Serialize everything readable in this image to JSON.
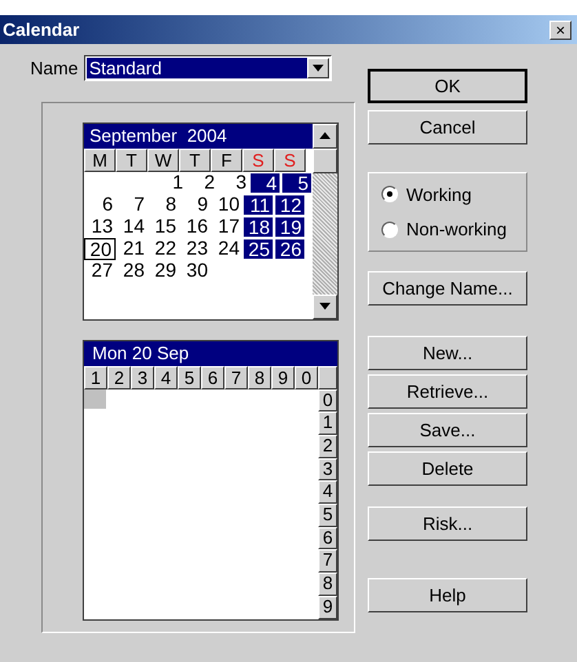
{
  "window": {
    "title": "Calendar",
    "close": "×"
  },
  "name_field": {
    "label": "Name",
    "value": "Standard"
  },
  "month": {
    "title": "September  2004",
    "weekdays": [
      {
        "label": "M",
        "weekend": false
      },
      {
        "label": "T",
        "weekend": false
      },
      {
        "label": "W",
        "weekend": false
      },
      {
        "label": "T",
        "weekend": false
      },
      {
        "label": "F",
        "weekend": false
      },
      {
        "label": "S",
        "weekend": true
      },
      {
        "label": "S",
        "weekend": true
      }
    ],
    "weeks": [
      [
        {
          "day": "1",
          "non_working": false,
          "current": false
        },
        {
          "day": "2",
          "non_working": false,
          "current": false
        },
        {
          "day": "3",
          "non_working": false,
          "current": false
        },
        {
          "day": "4",
          "non_working": true,
          "current": false
        },
        {
          "day": "5",
          "non_working": true,
          "current": false
        }
      ],
      [
        {
          "day": "6",
          "non_working": false,
          "current": false
        },
        {
          "day": "7",
          "non_working": false,
          "current": false
        },
        {
          "day": "8",
          "non_working": false,
          "current": false
        },
        {
          "day": "9",
          "non_working": false,
          "current": false
        },
        {
          "day": "10",
          "non_working": false,
          "current": false
        },
        {
          "day": "11",
          "non_working": true,
          "current": false
        },
        {
          "day": "12",
          "non_working": true,
          "current": false
        }
      ],
      [
        {
          "day": "13",
          "non_working": false,
          "current": false
        },
        {
          "day": "14",
          "non_working": false,
          "current": false
        },
        {
          "day": "15",
          "non_working": false,
          "current": false
        },
        {
          "day": "16",
          "non_working": false,
          "current": false
        },
        {
          "day": "17",
          "non_working": false,
          "current": false
        },
        {
          "day": "18",
          "non_working": true,
          "current": false
        },
        {
          "day": "19",
          "non_working": true,
          "current": false
        }
      ],
      [
        {
          "day": "20",
          "non_working": false,
          "current": true
        },
        {
          "day": "21",
          "non_working": false,
          "current": false
        },
        {
          "day": "22",
          "non_working": false,
          "current": false
        },
        {
          "day": "23",
          "non_working": false,
          "current": false
        },
        {
          "day": "24",
          "non_working": false,
          "current": false
        },
        {
          "day": "25",
          "non_working": true,
          "current": false
        },
        {
          "day": "26",
          "non_working": true,
          "current": false
        }
      ],
      [
        {
          "day": "27",
          "non_working": false,
          "current": false
        },
        {
          "day": "28",
          "non_working": false,
          "current": false
        },
        {
          "day": "29",
          "non_working": false,
          "current": false
        },
        {
          "day": "30",
          "non_working": false,
          "current": false
        }
      ]
    ]
  },
  "day_grid": {
    "title": "Mon 20 Sep",
    "columns": [
      "1",
      "2",
      "3",
      "4",
      "5",
      "6",
      "7",
      "8",
      "9",
      "0"
    ],
    "rows": [
      {
        "label": "0",
        "selected": true
      },
      {
        "label": "1",
        "selected": false
      },
      {
        "label": "2",
        "selected": false
      },
      {
        "label": "3",
        "selected": false
      },
      {
        "label": "4",
        "selected": false
      },
      {
        "label": "5",
        "selected": false
      },
      {
        "label": "6",
        "selected": false
      },
      {
        "label": "7",
        "selected": false
      },
      {
        "label": "8",
        "selected": false
      },
      {
        "label": "9",
        "selected": false
      }
    ]
  },
  "buttons_top": [
    {
      "label": "OK",
      "default": true
    },
    {
      "label": "Cancel",
      "default": false
    }
  ],
  "day_type": [
    {
      "label": "Working",
      "selected": true
    },
    {
      "label": "Non-working",
      "selected": false
    }
  ],
  "change_name": "Change Name...",
  "buttons_middle": [
    "New...",
    "Retrieve...",
    "Save...",
    "Delete"
  ],
  "risk": "Risk...",
  "help": "Help"
}
